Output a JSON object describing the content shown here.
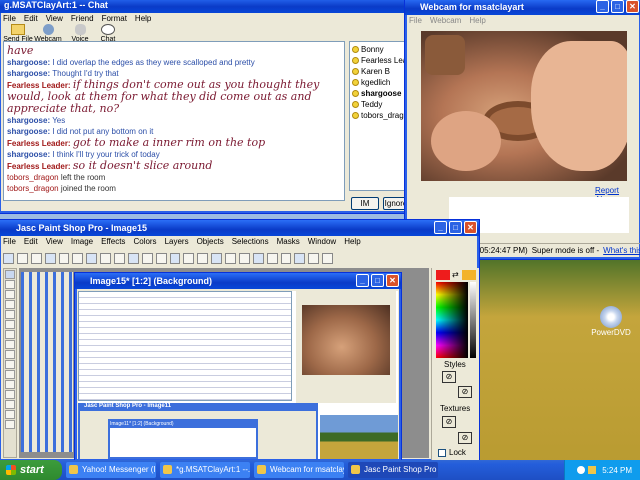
{
  "chat": {
    "title": "g.MSATClayArt:1 -- Chat",
    "menu": [
      "File",
      "Edit",
      "View",
      "Friend",
      "Format",
      "Help"
    ],
    "toolbar": [
      "Send File",
      "Webcam",
      "Voice",
      "Chat"
    ],
    "log": [
      {
        "nick": "",
        "kind": "fl",
        "text": "have",
        "fancy": true
      },
      {
        "nick": "shargoose:",
        "kind": "me",
        "text": "I did overlap the edges as they were scalloped and pretty",
        "fancy": false
      },
      {
        "nick": "shargoose:",
        "kind": "me",
        "text": "Thought I'd try that",
        "fancy": false
      },
      {
        "nick": "Fearless Leader:",
        "kind": "fl",
        "text": "if things don't come out as you thought they",
        "fancy": true
      },
      {
        "nick": "",
        "kind": "fl",
        "text": "would, look at them for what they did come out as and",
        "fancy": true
      },
      {
        "nick": "",
        "kind": "fl",
        "text": "appreciate that, no?",
        "fancy": true
      },
      {
        "nick": "shargoose:",
        "kind": "me",
        "text": "Yes",
        "fancy": false
      },
      {
        "nick": "shargoose:",
        "kind": "me",
        "text": "I did not put any bottom on it",
        "fancy": false
      },
      {
        "nick": "Fearless Leader:",
        "kind": "fl",
        "text": "got to make a inner rim on the top",
        "fancy": true
      },
      {
        "nick": "shargoose:",
        "kind": "me",
        "text": "I think I'll try your trick of today",
        "fancy": false
      },
      {
        "nick": "Fearless Leader:",
        "kind": "fl",
        "text": "so it doesn't slice around",
        "fancy": true
      }
    ],
    "system": [
      {
        "who": "tobors_dragon",
        "text": "left the room"
      },
      {
        "who": "tobors_dragon",
        "text": "joined the room"
      }
    ],
    "users": [
      "Bonny",
      "Fearless Lead",
      "Karen B",
      "kgedlich",
      "shargoose",
      "Teddy",
      "tobors_dragon"
    ],
    "im_label": "IM",
    "ignore_label": "Ignore"
  },
  "webcam": {
    "title": "Webcam for msatclayart",
    "menu": [
      "File",
      "Webcam",
      "Help"
    ],
    "report_abuse": "Report Abuse",
    "time": "(05:24:47 PM)",
    "super_mode": "Super mode is off -",
    "whats_this": "What's this?"
  },
  "psp": {
    "title": "Jasc Paint Shop Pro - Image15",
    "menu": [
      "File",
      "Edit",
      "View",
      "Image",
      "Effects",
      "Colors",
      "Layers",
      "Objects",
      "Selections",
      "Masks",
      "Window",
      "Help"
    ],
    "styles_label": "Styles",
    "textures_label": "Textures",
    "lock_label": "Lock",
    "image_title": "Image15* [1:2] (Background)",
    "nested_title": "Jasc Paint Shop Pro - Image11",
    "nested_image_title": "Image11* [1:2] (Background)"
  },
  "desktop": {
    "icon_label": "PowerDVD"
  },
  "taskbar": {
    "start": "start",
    "tasks": [
      "Yahoo! Messenger (I...",
      "*g.MSATClayArt:1 --...",
      "Webcam for msatclay...",
      "Jasc Paint Shop Pro -..."
    ],
    "clock": "5:24 PM"
  },
  "colors": {
    "xp_blue": "#0a3bc8",
    "nick_red": "#a01818",
    "nick_blue": "#2c4fa8",
    "start_green": "#2f8a2f"
  }
}
